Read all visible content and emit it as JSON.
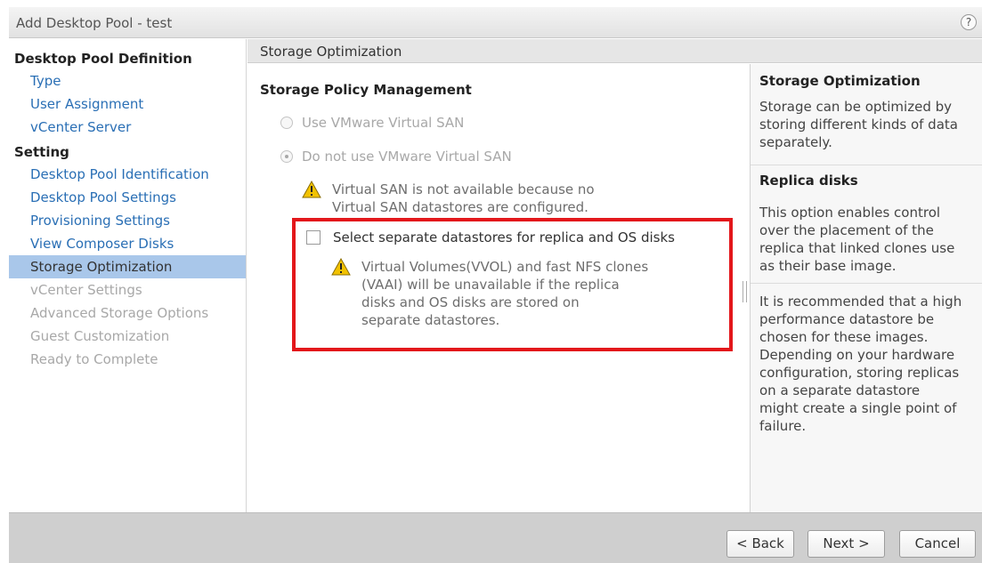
{
  "window": {
    "title": "Add Desktop Pool - test",
    "help_glyph": "?"
  },
  "nav": {
    "section_definition": "Desktop Pool Definition",
    "definition_items": [
      "Type",
      "User Assignment",
      "vCenter Server"
    ],
    "section_setting": "Setting",
    "setting_items": [
      "Desktop Pool Identification",
      "Desktop Pool Settings",
      "Provisioning Settings",
      "View Composer Disks",
      "Storage Optimization",
      "vCenter Settings",
      "Advanced Storage Options",
      "Guest Customization",
      "Ready to Complete"
    ],
    "selected_item": "Storage Optimization"
  },
  "main": {
    "header": "Storage Optimization",
    "heading": "Storage Policy Management",
    "radio_use_vsan": "Use VMware Virtual SAN",
    "radio_no_vsan": "Do not use VMware Virtual SAN",
    "vsan_warning_line1": "Virtual SAN is not available because no",
    "vsan_warning_line2": "Virtual SAN datastores are configured.",
    "checkbox_label": "Select separate datastores for replica and OS disks",
    "checkbox_checked": false,
    "vvol_warning_line1": "Virtual Volumes(VVOL) and fast NFS clones",
    "vvol_warning_line2": "(VAAI) will be unavailable if the replica",
    "vvol_warning_line3": "disks and OS disks are stored on",
    "vvol_warning_line4": "separate datastores."
  },
  "help": {
    "title1": "Storage Optimization",
    "text1_l1": "Storage can be optimized by",
    "text1_l2": "storing different kinds of data",
    "text1_l3": "separately.",
    "title2": "Replica disks",
    "text2_l1": "This option enables control",
    "text2_l2": "over the placement of the",
    "text2_l3": "replica that linked clones use",
    "text2_l4": "as their base image.",
    "text3_l1": "It is recommended that a high",
    "text3_l2": "performance datastore be",
    "text3_l3": "chosen for these images.",
    "text3_l4": "Depending on your hardware",
    "text3_l5": "configuration, storing replicas",
    "text3_l6": "on a separate datastore",
    "text3_l7": "might create a single point of",
    "text3_l8": "failure."
  },
  "footer": {
    "back": "< Back",
    "next": "Next >",
    "cancel": "Cancel"
  },
  "colors": {
    "highlight_border": "#e3171b",
    "nav_selected": "#a9c7ea",
    "link": "#2a6fb5",
    "warning_icon": "#f2c200"
  },
  "icons": {
    "warning": "warning-triangle-icon",
    "help": "help-circle-icon",
    "splitter": "splitter-grip-icon"
  }
}
